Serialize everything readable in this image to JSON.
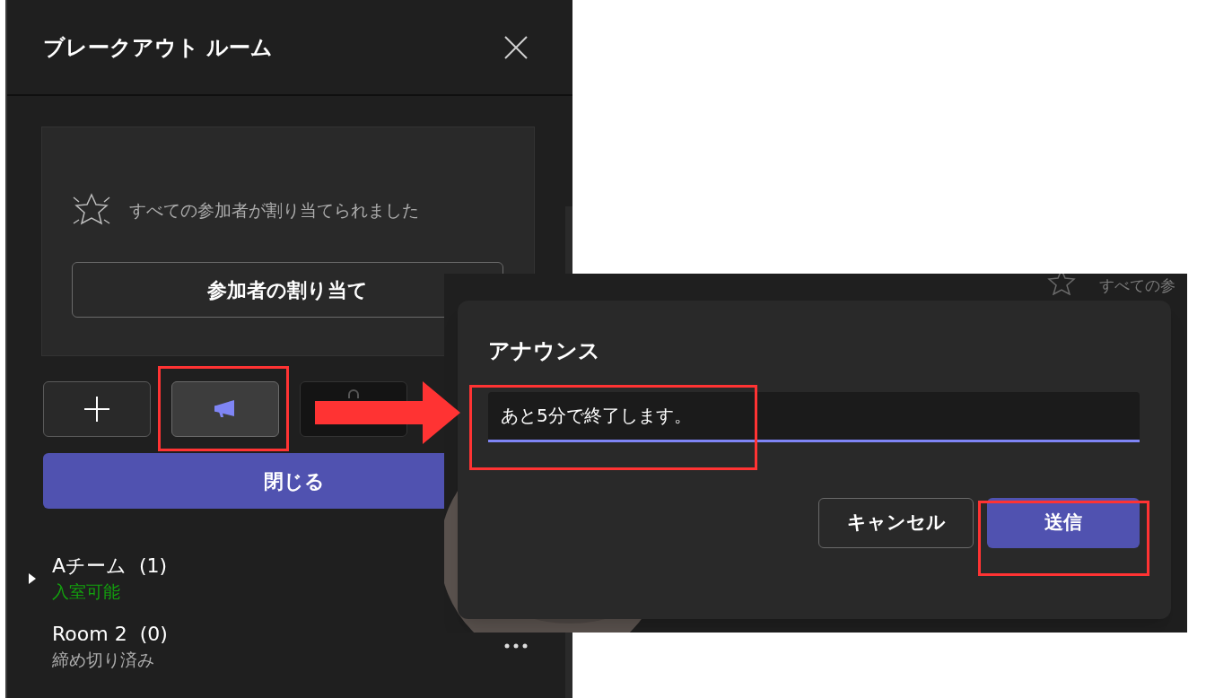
{
  "panel": {
    "title": "ブレークアウト ルーム",
    "notice": "すべての参加者が割り当てられました",
    "assign_button": "参加者の割り当て",
    "toolbar": [
      {
        "kind": "add",
        "selected": false
      },
      {
        "kind": "announce",
        "selected": true
      },
      {
        "kind": "other",
        "selected": false
      }
    ],
    "close_button": "閉じる",
    "rooms": [
      {
        "name": "Aチーム",
        "count": "(1)",
        "status": "入室可能",
        "color": "#13a10e",
        "selected": true,
        "menu_visible": false
      },
      {
        "name": "Room 2",
        "count": "(0)",
        "status": "締め切り済み",
        "color": "#adadad",
        "selected": false,
        "menu_visible": true
      }
    ]
  },
  "background_fragment": "すべての参",
  "dialog": {
    "title": "アナウンス",
    "input_value": "あと5分で終了します。",
    "buttons": [
      {
        "label": "キャンセル",
        "kind": "secondary"
      },
      {
        "label": "送信",
        "kind": "primary"
      }
    ]
  }
}
